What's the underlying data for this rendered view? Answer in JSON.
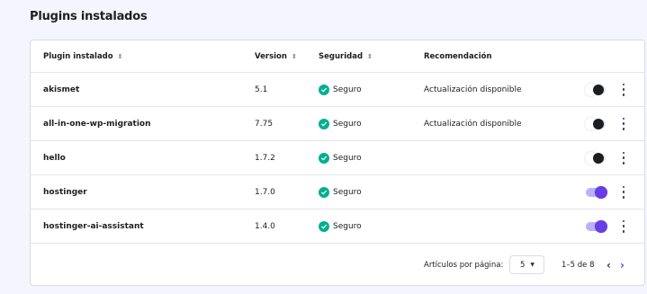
{
  "page": {
    "title": "Plugins instalados"
  },
  "table": {
    "headers": {
      "name": "Plugin instalado",
      "version": "Version",
      "security": "Seguridad",
      "recommendation": "Recomendación"
    },
    "sort_icon": "⇕",
    "rows": [
      {
        "name": "akismet",
        "version": "5.1",
        "security": "Seguro",
        "recommendation": "Actualización disponible",
        "enabled": false
      },
      {
        "name": "all-in-one-wp-migration",
        "version": "7.75",
        "security": "Seguro",
        "recommendation": "Actualización disponible",
        "enabled": false
      },
      {
        "name": "hello",
        "version": "1.7.2",
        "security": "Seguro",
        "recommendation": "",
        "enabled": false
      },
      {
        "name": "hostinger",
        "version": "1.7.0",
        "security": "Seguro",
        "recommendation": "",
        "enabled": true
      },
      {
        "name": "hostinger-ai-assistant",
        "version": "1.4.0",
        "security": "Seguro",
        "recommendation": "",
        "enabled": true
      }
    ]
  },
  "pagination": {
    "per_page_label": "Artículos por página:",
    "per_page_value": "5",
    "range": "1–5 de 8",
    "prev_icon": "‹",
    "next_icon": "›"
  },
  "colors": {
    "accent": "#673de6",
    "secure": "#00b090",
    "background": "#f4f5ff"
  }
}
